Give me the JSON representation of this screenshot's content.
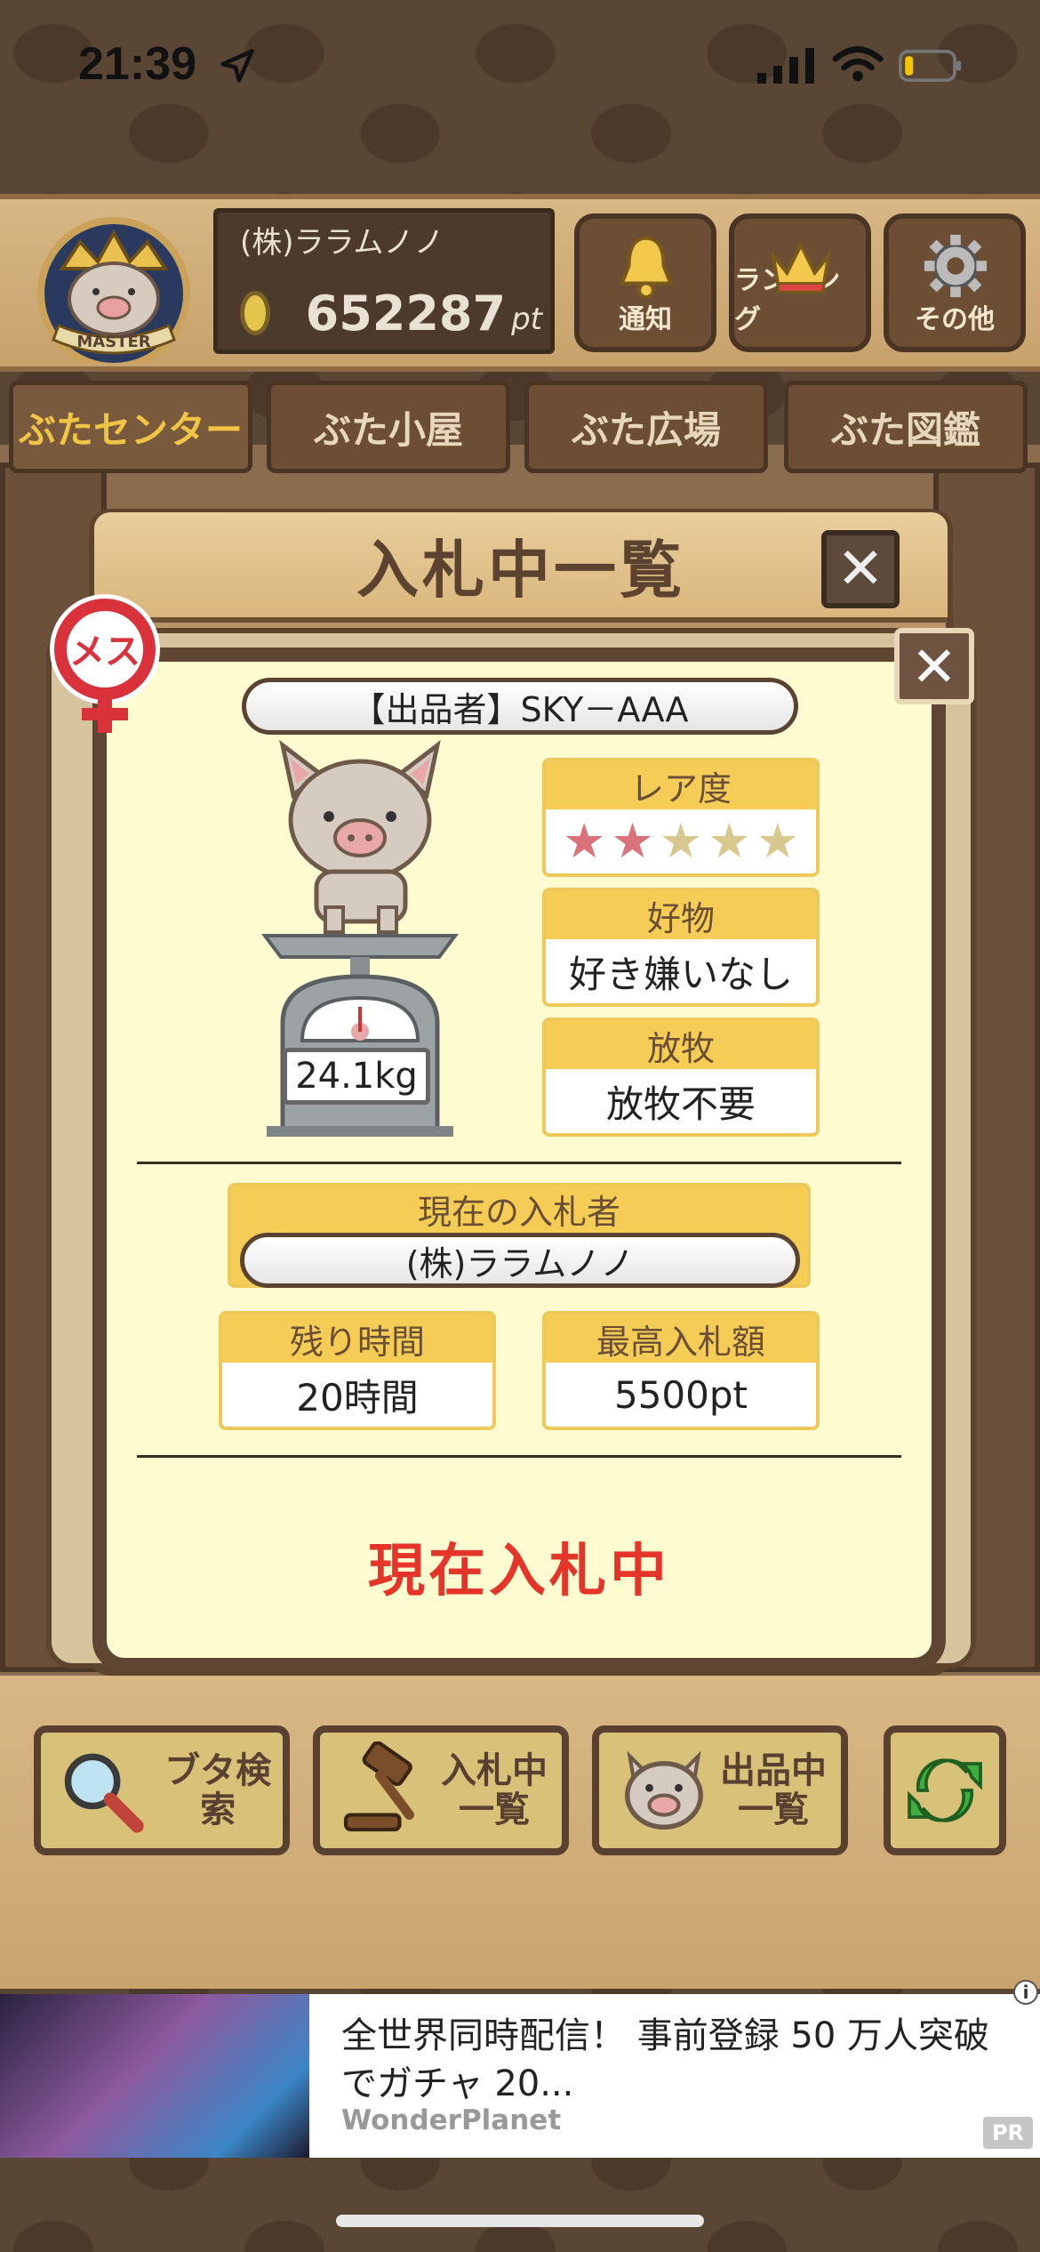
{
  "status_bar": {
    "time": "21:39"
  },
  "header": {
    "badge_text": "MASTER",
    "user_name": "(株)ララムノノ",
    "points_value": "652287",
    "points_unit": "pt",
    "buttons": [
      {
        "label": "通知",
        "icon": "bell-icon"
      },
      {
        "label": "ランキング",
        "icon": "crown-icon"
      },
      {
        "label": "その他",
        "icon": "gear-icon"
      }
    ]
  },
  "nav_tabs": [
    {
      "label": "ぶたセンター",
      "active": true
    },
    {
      "label": "ぶた小屋",
      "active": false
    },
    {
      "label": "ぶた広場",
      "active": false
    },
    {
      "label": "ぶた図鑑",
      "active": false
    }
  ],
  "modal": {
    "title": "入札中一覧",
    "close_glyph": "✕",
    "gender_label": "メス",
    "seller": "【出品者】SKY－AAA",
    "weight": "24.1kg",
    "rarity": {
      "label": "レア度",
      "filled": 2,
      "total": 5
    },
    "favorite": {
      "label": "好物",
      "value": "好き嫌いなし"
    },
    "grazing": {
      "label": "放牧",
      "value": "放牧不要"
    },
    "current_bidder": {
      "label": "現在の入札者",
      "value": "(株)ララムノノ"
    },
    "remaining_time": {
      "label": "残り時間",
      "value": "20時間"
    },
    "highest_bid": {
      "label": "最高入札額",
      "value": "5500pt"
    },
    "status": "現在入札中"
  },
  "bottom_buttons": [
    {
      "label": "ブタ検索",
      "icon": "magnifier-icon"
    },
    {
      "label": "入札中\n一覧",
      "icon": "gavel-icon"
    },
    {
      "label": "出品中\n一覧",
      "icon": "pig-face-icon"
    },
    {
      "label": "",
      "icon": "refresh-icon"
    }
  ],
  "ad": {
    "title": "全世界同時配信！ 事前登録 50 万人突破でガチャ 20...",
    "sponsor": "WonderPlanet",
    "pr": "PR",
    "info": "i"
  },
  "colors": {
    "accent_yellow": "#f4cc56",
    "status_red": "#e5352b",
    "wood_dark": "#5f4632",
    "card_bg": "#fefbd0"
  }
}
